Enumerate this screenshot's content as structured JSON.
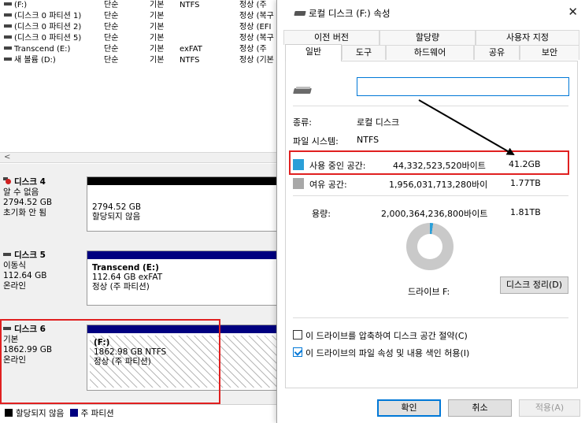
{
  "volumes": [
    {
      "name": "(F:)",
      "layout": "단순",
      "type": "기본",
      "fs": "NTFS",
      "status": "정상 (주"
    },
    {
      "name": "(디스크 0 파티션 1)",
      "layout": "단순",
      "type": "기본",
      "fs": "",
      "status": "정상 (복구"
    },
    {
      "name": "(디스크 0 파티션 2)",
      "layout": "단순",
      "type": "기본",
      "fs": "",
      "status": "정상 (EFI"
    },
    {
      "name": "(디스크 0 파티션 5)",
      "layout": "단순",
      "type": "기본",
      "fs": "",
      "status": "정상 (복구"
    },
    {
      "name": "Transcend (E:)",
      "layout": "단순",
      "type": "기본",
      "fs": "exFAT",
      "status": "정상 (주"
    },
    {
      "name": "새 볼륨 (D:)",
      "layout": "단순",
      "type": "기본",
      "fs": "NTFS",
      "status": "정상 (기본"
    }
  ],
  "disks": [
    {
      "title": "디스크 4",
      "line1": "알 수 없음",
      "line2": "2794.52 GB",
      "line3": "초기화 안 됨",
      "part": {
        "name": "",
        "line1": "2794.52 GB",
        "line2": "할당되지 않음"
      }
    },
    {
      "title": "디스크 5",
      "line1": "이동식",
      "line2": "112.64 GB",
      "line3": "온라인",
      "part": {
        "name": "Transcend  (E:)",
        "line1": "112.64 GB exFAT",
        "line2": "정상 (주 파티션)"
      }
    },
    {
      "title": "디스크 6",
      "line1": "기본",
      "line2": "1862.99 GB",
      "line3": "온라인",
      "part": {
        "name": "(F:)",
        "line1": "1862.98 GB NTFS",
        "line2": "정상 (주 파티션)"
      }
    }
  ],
  "legend": {
    "unallocated": "할당되지 않음",
    "primary": "주 파티션"
  },
  "dialog": {
    "title": "로컬 디스크 (F:) 속성",
    "close": "✕",
    "tabs_row1": [
      "이전 버전",
      "할당량",
      "사용자 지정"
    ],
    "tabs_row2": [
      "일반",
      "도구",
      "하드웨어",
      "공유",
      "보안"
    ],
    "name_value": "",
    "type_label": "종류:",
    "type_value": "로컬 디스크",
    "fs_label": "파일 시스템:",
    "fs_value": "NTFS",
    "used_label": "사용 중인 공간:",
    "used_bytes": "44,332,523,520바이트",
    "used_human": "41.2GB",
    "free_label": "여유 공간:",
    "free_bytes": "1,956,031,713,280바이",
    "free_human": "1.77TB",
    "cap_label": "용량:",
    "cap_bytes": "2,000,364,236,800바이트",
    "cap_human": "1.81TB",
    "used_fraction": 0.022,
    "drive_label": "드라이브 F:",
    "cleanup_button": "디스크 정리(D)",
    "compress_label": "이 드라이브를 압축하여 디스크 공간 절약(C)",
    "index_label": "이 드라이브의 파일 속성 및 내용 색인 허용(I)",
    "ok": "확인",
    "cancel": "취소",
    "apply": "적용(A)"
  },
  "colors": {
    "used": "#2a9fd8",
    "free": "#a8a8a8",
    "primary_partition": "#000080",
    "highlight": "#e02020"
  }
}
